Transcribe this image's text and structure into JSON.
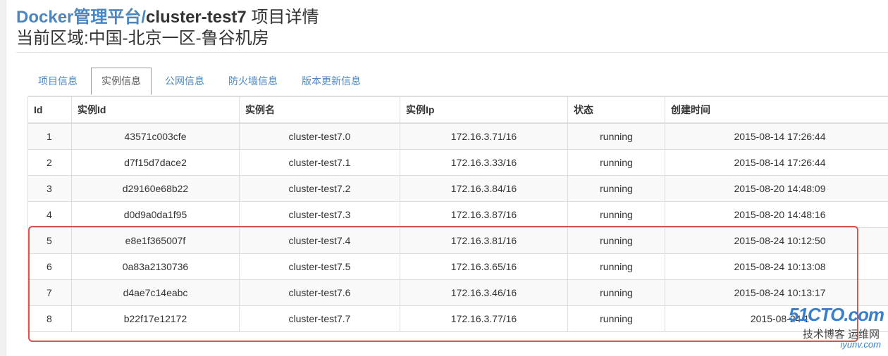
{
  "header": {
    "brand": "Docker管理平台/",
    "project": "cluster-test7",
    "suffix": " 项目详情",
    "region": "当前区域:中国-北京一区-鲁谷机房"
  },
  "tabs": [
    {
      "label": "项目信息",
      "active": false
    },
    {
      "label": "实例信息",
      "active": true
    },
    {
      "label": "公网信息",
      "active": false
    },
    {
      "label": "防火墙信息",
      "active": false
    },
    {
      "label": "版本更新信息",
      "active": false
    }
  ],
  "table": {
    "columns": [
      "Id",
      "实例Id",
      "实例名",
      "实例Ip",
      "状态",
      "创建时间"
    ],
    "rows": [
      [
        "1",
        "43571c003cfe",
        "cluster-test7.0",
        "172.16.3.71/16",
        "running",
        "2015-08-14 17:26:44"
      ],
      [
        "2",
        "d7f15d7dace2",
        "cluster-test7.1",
        "172.16.3.33/16",
        "running",
        "2015-08-14 17:26:44"
      ],
      [
        "3",
        "d29160e68b22",
        "cluster-test7.2",
        "172.16.3.84/16",
        "running",
        "2015-08-20 14:48:09"
      ],
      [
        "4",
        "d0d9a0da1f95",
        "cluster-test7.3",
        "172.16.3.87/16",
        "running",
        "2015-08-20 14:48:16"
      ],
      [
        "5",
        "e8e1f365007f",
        "cluster-test7.4",
        "172.16.3.81/16",
        "running",
        "2015-08-24 10:12:50"
      ],
      [
        "6",
        "0a83a2130736",
        "cluster-test7.5",
        "172.16.3.65/16",
        "running",
        "2015-08-24 10:13:08"
      ],
      [
        "7",
        "d4ae7c14eabc",
        "cluster-test7.6",
        "172.16.3.46/16",
        "running",
        "2015-08-24 10:13:17"
      ],
      [
        "8",
        "b22f17e12172",
        "cluster-test7.7",
        "172.16.3.77/16",
        "running",
        "2015-08-24 1"
      ]
    ]
  },
  "watermark": {
    "line1": "51CTO.com",
    "line2": "技术博客 运维网",
    "line3": "iyunv.com"
  },
  "colors": {
    "brand": "#4a86c0",
    "highlight": "#d9534f"
  }
}
